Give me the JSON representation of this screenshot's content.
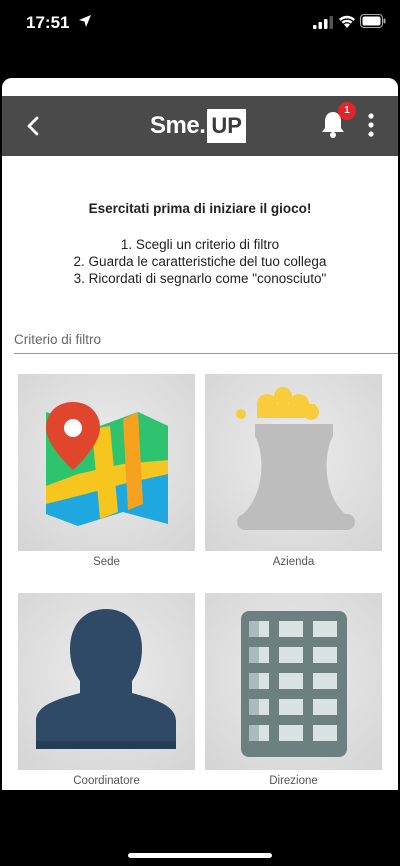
{
  "status_bar": {
    "time": "17:51"
  },
  "header": {
    "logo_left": "Sme.",
    "logo_right": "UP",
    "notification_count": "1"
  },
  "intro": {
    "title": "Esercitati prima di iniziare il gioco!",
    "steps": [
      "1. Scegli un criterio di filtro",
      "2. Guarda le caratteristiche del tuo collega",
      "3. Ricordati di segnarlo come \"conosciuto\""
    ]
  },
  "filter": {
    "label": "Criterio di filtro"
  },
  "cards": [
    {
      "label": "Sede",
      "icon": "map-pin-icon"
    },
    {
      "label": "Azienda",
      "icon": "factory-chimney-icon"
    },
    {
      "label": "Coordinatore",
      "icon": "person-silhouette-icon"
    },
    {
      "label": "Direzione",
      "icon": "building-grid-icon"
    }
  ],
  "colors": {
    "header_bg": "#4a4a4a",
    "badge": "#e3242b",
    "person": "#2e4a66",
    "building": "#6d8080"
  }
}
